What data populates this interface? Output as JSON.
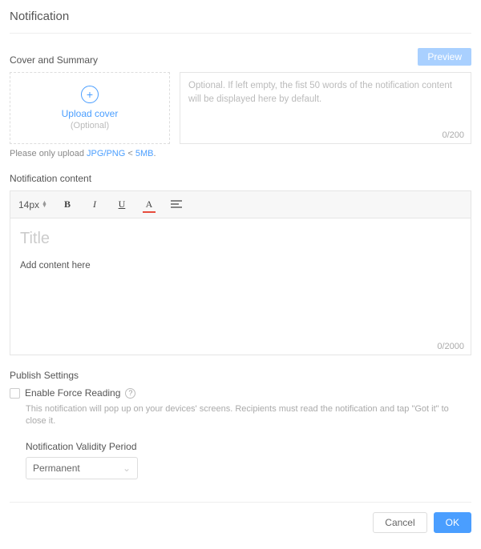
{
  "page": {
    "title": "Notification"
  },
  "cover": {
    "section_label": "Cover and Summary",
    "upload_label": "Upload cover",
    "optional_label": "(Optional)",
    "hint_prefix": "Please only upload ",
    "hint_formats": "JPG/PNG",
    "hint_sep": " < ",
    "hint_size": "5MB",
    "hint_suffix": "."
  },
  "summary": {
    "placeholder": "Optional. If left empty, the fist 50 words of the notification content will be displayed here by default.",
    "counter": "0/200"
  },
  "preview": {
    "label": "Preview"
  },
  "content": {
    "section_label": "Notification content",
    "fontsize": "14px",
    "title_placeholder": "Title",
    "body_placeholder": "Add content here",
    "counter": "0/2000"
  },
  "publish": {
    "section_label": "Publish Settings",
    "force_reading_label": "Enable Force Reading",
    "force_reading_desc": "This notification will pop up on your devices' screens. Recipients must read the notification and tap \"Got it\" to close it.",
    "validity_label": "Notification Validity Period",
    "validity_value": "Permanent"
  },
  "footer": {
    "cancel": "Cancel",
    "ok": "OK"
  }
}
